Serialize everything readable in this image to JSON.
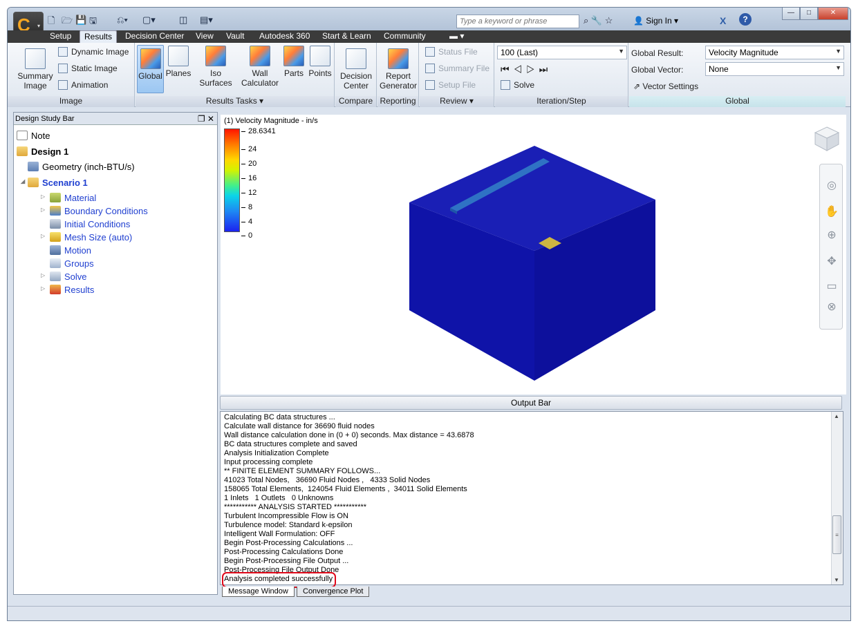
{
  "app": {
    "logo_letter": "C"
  },
  "search": {
    "placeholder": "Type a keyword or phrase"
  },
  "header": {
    "sign_in": "Sign In",
    "help": "?",
    "x_icon": "X"
  },
  "window_controls": {
    "minimize": "—",
    "maximize": "□",
    "close": "✕"
  },
  "tabs": [
    "Setup",
    "Results",
    "Decision Center",
    "View",
    "Vault",
    "Autodesk 360",
    "Start & Learn",
    "Community"
  ],
  "ribbon": {
    "image": {
      "summary_line1": "Summary",
      "summary_line2": "Image",
      "dynamic_image": "Dynamic Image",
      "static_image": "Static Image",
      "animation": "Animation",
      "footer": "Image"
    },
    "results_tasks": {
      "global": "Global",
      "planes": "Planes",
      "iso_surfaces": "Iso Surfaces",
      "wall_line1": "Wall",
      "wall_line2": "Calculator",
      "parts": "Parts",
      "points": "Points",
      "footer": "Results Tasks ▾"
    },
    "compare": {
      "dc_line1": "Decision",
      "dc_line2": "Center",
      "footer": "Compare"
    },
    "reporting": {
      "rg_line1": "Report",
      "rg_line2": "Generator",
      "footer": "Reporting"
    },
    "review": {
      "status_file": "Status File",
      "summary_file": "Summary File",
      "setup_file": "Setup File",
      "footer": "Review ▾"
    },
    "iteration": {
      "value": "100 (Last)",
      "solve": "Solve",
      "footer": "Iteration/Step"
    },
    "global": {
      "result_label": "Global Result:",
      "result_value": "Velocity Magnitude",
      "vector_label": "Global Vector:",
      "vector_value": "None",
      "vector_settings": "Vector Settings",
      "footer": "Global"
    }
  },
  "design_study_bar": {
    "title": "Design Study Bar",
    "controls": "❐ ✕",
    "tree": {
      "note": "Note",
      "design": "Design 1",
      "geometry": "Geometry (inch-BTU/s)",
      "scenario": "Scenario 1",
      "material": "Material",
      "boundary_conditions": "Boundary Conditions",
      "initial_conditions": "Initial Conditions",
      "mesh_size": "Mesh Size (auto)",
      "motion": "Motion",
      "groups": "Groups",
      "solve": "Solve",
      "results": "Results"
    }
  },
  "viewport": {
    "legend_title": "(1) Velocity Magnitude - in/s",
    "legend_ticks": [
      "28.6341",
      "24",
      "20",
      "16",
      "12",
      "8",
      "4",
      "0"
    ]
  },
  "output_bar": {
    "title": "Output Bar",
    "lines": [
      "Calculating BC data structures ...",
      "Calculate wall distance for 36690 fluid nodes",
      "Wall distance calculation done in (0 + 0) seconds. Max distance = 43.6878",
      "BC data structures complete and saved",
      "Analysis Initialization Complete",
      "Input processing complete",
      "** FINITE ELEMENT SUMMARY FOLLOWS...",
      "41023 Total Nodes,   36690 Fluid Nodes ,   4333 Solid Nodes",
      "158065 Total Elements,  124054 Fluid Elements ,  34011 Solid Elements",
      "1 Inlets   1 Outlets   0 Unknowns",
      "*********** ANALYSIS STARTED ***********",
      "Turbulent Incompressible Flow is ON",
      "Turbulence model: Standard k-epsilon",
      "Intelligent Wall Formulation: OFF",
      "Begin Post-Processing Calculations ...",
      "Post-Processing Calculations Done",
      "Begin Post-Processing File Output ...",
      "Post-Processing File Output Done",
      "Analysis completed successfully"
    ],
    "tabs": [
      "Message Window",
      "Convergence Plot"
    ]
  }
}
